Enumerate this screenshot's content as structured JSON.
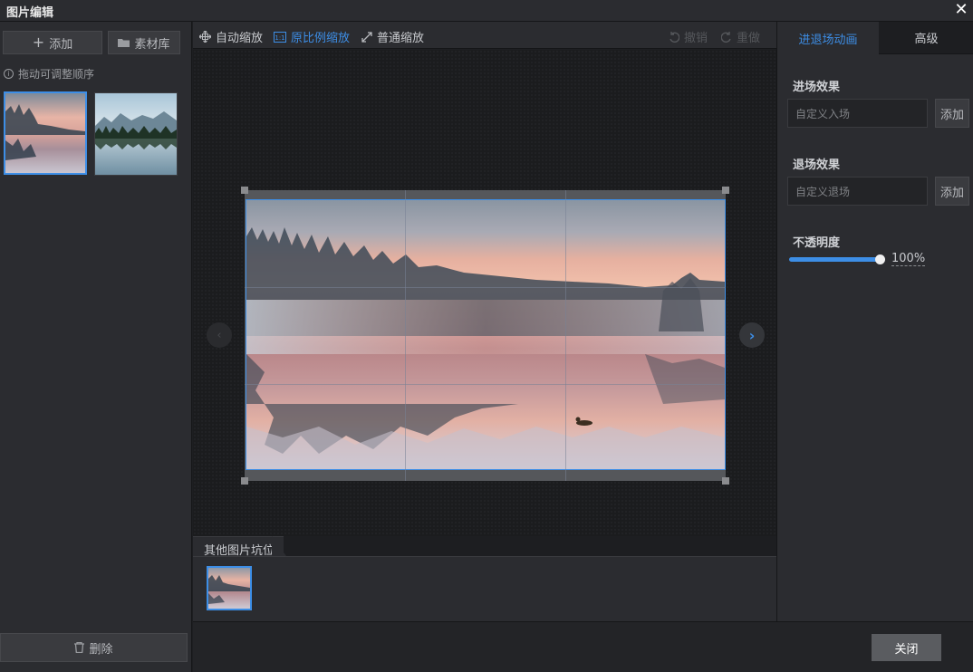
{
  "window": {
    "title": "图片编辑",
    "close_glyph": "✕"
  },
  "left": {
    "add_label": "添加",
    "library_label": "素材库",
    "hint": "拖动可调整顺序",
    "delete_label": "删除",
    "thumbnails": [
      "lake-sunset-fog",
      "mountain-lake-reflection"
    ]
  },
  "toolbar": {
    "auto_zoom": "自动缩放",
    "original_ratio": "原比例缩放",
    "normal_zoom": "普通缩放",
    "undo": "撤销",
    "redo": "重做"
  },
  "canvas": {
    "other_slots_label": "其他图片坑位"
  },
  "right": {
    "tab_anim": "进退场动画",
    "tab_advanced": "高级",
    "enter_label": "进场效果",
    "enter_placeholder": "自定义入场",
    "enter_add": "添加",
    "exit_label": "退场效果",
    "exit_placeholder": "自定义退场",
    "exit_add": "添加",
    "opacity_label": "不透明度",
    "opacity_value": "100%",
    "opacity_level": 1.0
  },
  "footer": {
    "close_label": "关闭"
  },
  "colors": {
    "accent": "#3d8ee6",
    "panel": "#2b2c30",
    "canvas": "#1b1c1e"
  }
}
